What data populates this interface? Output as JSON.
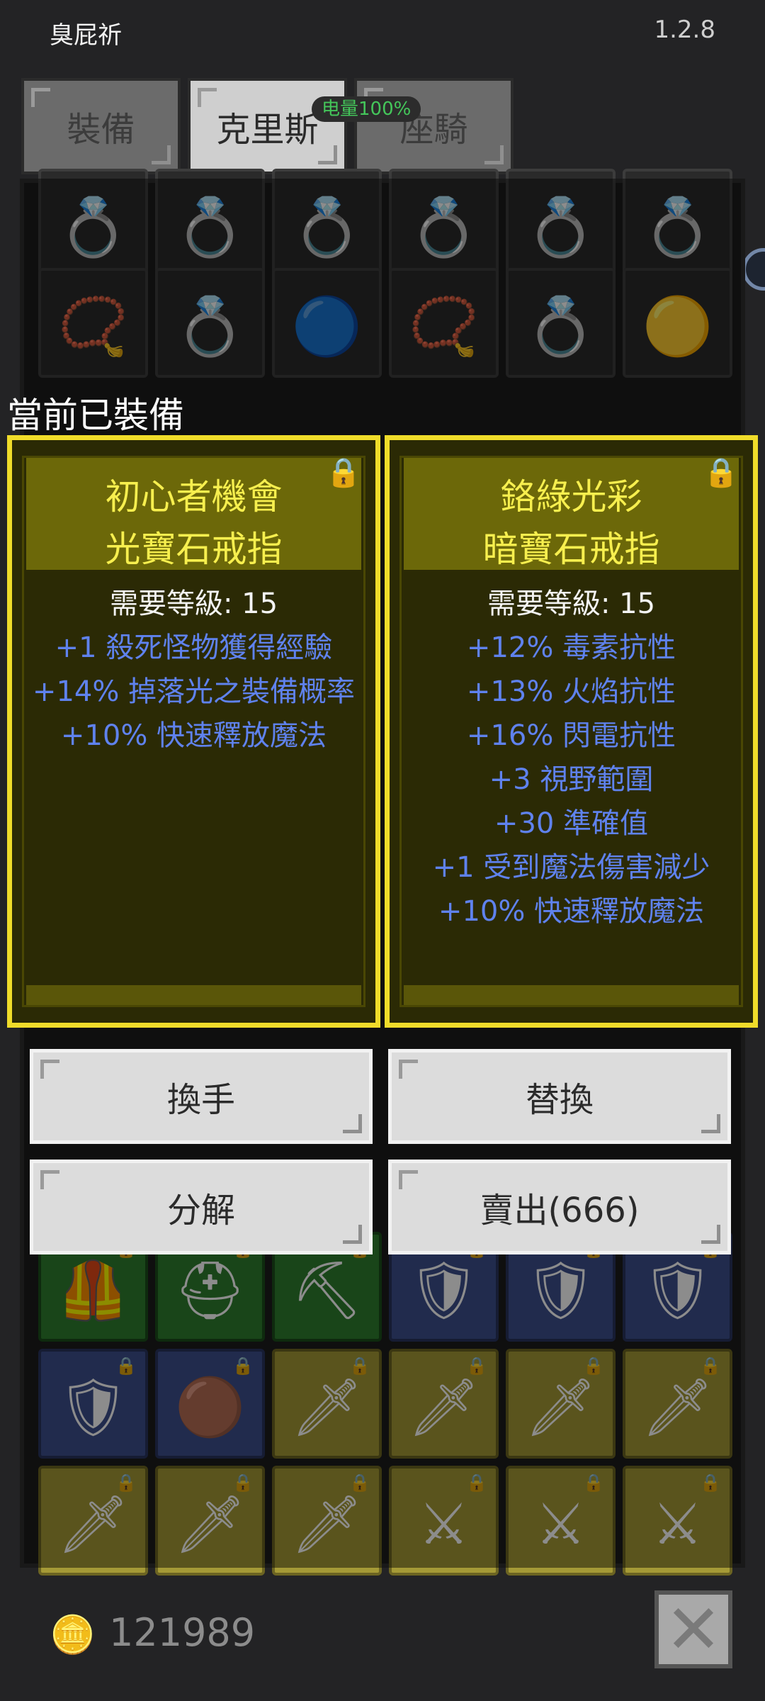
{
  "header": {
    "title": "臭屁祈",
    "version": "1.2.8"
  },
  "tabs": [
    {
      "label": "裝備",
      "active": false
    },
    {
      "label": "克里斯",
      "active": true
    },
    {
      "label": "座騎",
      "active": false
    }
  ],
  "battery": {
    "label": "电量100%"
  },
  "equipped": {
    "header": "當前已裝備",
    "cards": [
      {
        "name_line1": "初心者機會",
        "name_line2": "光寶石戒指",
        "requirement": "需要等級: 15",
        "stats": [
          "+1 殺死怪物獲得經驗",
          "+14% 掉落光之裝備概率",
          "+10% 快速釋放魔法"
        ],
        "locked": true
      },
      {
        "name_line1": "鉻綠光彩",
        "name_line2": "暗寶石戒指",
        "requirement": "需要等級: 15",
        "stats": [
          "+12% 毒素抗性",
          "+13% 火焰抗性",
          "+16% 閃電抗性",
          "+3 視野範圍",
          "+30 準確值",
          "+1 受到魔法傷害減少",
          "+10% 快速釋放魔法"
        ],
        "locked": true
      }
    ]
  },
  "actions": {
    "swap_hands": "換手",
    "replace": "替換",
    "disassemble": "分解",
    "sell": "賣出(666)"
  },
  "footer": {
    "coins": "121989"
  },
  "colors": {
    "card_border": "#f0dc2a",
    "stat_blue": "#5f82ee",
    "card_title": "#f7ef4e"
  }
}
